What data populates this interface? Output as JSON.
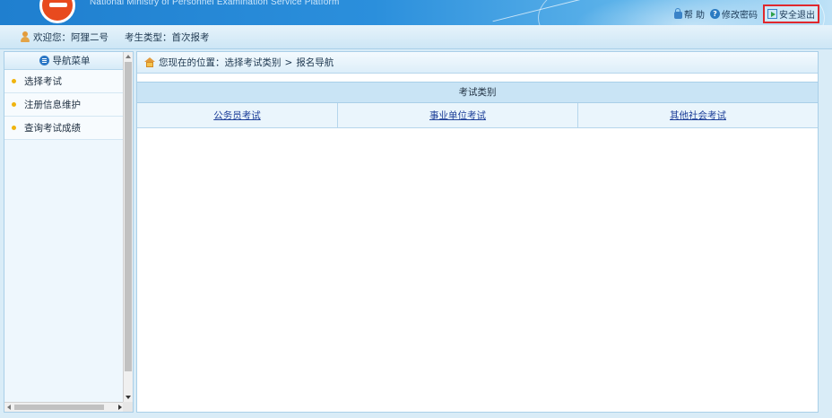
{
  "header": {
    "subtitle": "National Ministry of Personnel Examination Service Platform",
    "links": {
      "help": "帮 助",
      "change_password": "修改密码",
      "logout": "安全退出"
    },
    "accent_color": "#2b8fdc",
    "highlight_color": "#e0282d"
  },
  "infobar": {
    "welcome": "欢迎您：阿狸二号",
    "candidate_type": "考生类型：首次报考"
  },
  "sidebar": {
    "title": "导航菜单",
    "items": [
      {
        "label": "选择考试"
      },
      {
        "label": "注册信息维护"
      },
      {
        "label": "查询考试成绩"
      }
    ]
  },
  "main": {
    "breadcrumb": {
      "prefix": "您现在的位置：选择考试类别",
      "separator": ">",
      "current": "报名导航"
    },
    "table": {
      "header": "考试类别",
      "links": [
        "公务员考试",
        "事业单位考试",
        "其他社会考试"
      ]
    }
  }
}
